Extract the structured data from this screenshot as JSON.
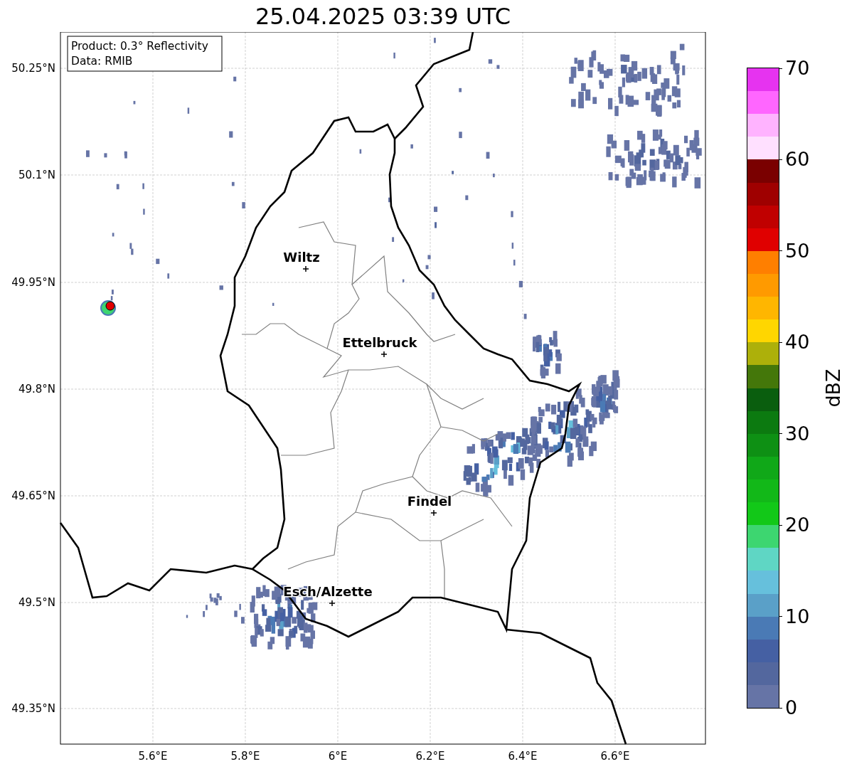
{
  "title": "25.04.2025 03:39 UTC",
  "annotation": [
    "Product: 0.3° Reflectivity",
    "Data: RMIB"
  ],
  "cities": [
    {
      "name": "Wiltz"
    },
    {
      "name": "Ettelbruck"
    },
    {
      "name": "Findel"
    },
    {
      "name": "Esch/Alzette"
    }
  ],
  "lat_ticks": [
    "50.25°N",
    "50.1°N",
    "49.95°N",
    "49.8°N",
    "49.65°N",
    "49.5°N",
    "49.35°N"
  ],
  "lon_ticks": [
    "5.6°E",
    "5.8°E",
    "6°E",
    "6.2°E",
    "6.4°E",
    "6.6°E"
  ],
  "colorbar": {
    "label": "dBZ",
    "ticks": [
      "70",
      "60",
      "50",
      "40",
      "30",
      "20",
      "10",
      "0"
    ],
    "bins": [
      {
        "color": "#6674a6"
      },
      {
        "color": "#53679e"
      },
      {
        "color": "#4560a3"
      },
      {
        "color": "#4a7ab5"
      },
      {
        "color": "#5aa0c8"
      },
      {
        "color": "#66c0dc"
      },
      {
        "color": "#5fd6c4"
      },
      {
        "color": "#3dd670"
      },
      {
        "color": "#12c818"
      },
      {
        "color": "#12b818"
      },
      {
        "color": "#10a818"
      },
      {
        "color": "#0e9014"
      },
      {
        "color": "#0c7a10"
      },
      {
        "color": "#0a5e0e"
      },
      {
        "color": "#44770a"
      },
      {
        "color": "#adb00a"
      },
      {
        "color": "#ffd600"
      },
      {
        "color": "#ffb600"
      },
      {
        "color": "#ff9a00"
      },
      {
        "color": "#ff7f00"
      },
      {
        "color": "#e00000"
      },
      {
        "color": "#c00000"
      },
      {
        "color": "#9f0000"
      },
      {
        "color": "#7a0000"
      },
      {
        "color": "#ffe0ff"
      },
      {
        "color": "#ffb3ff"
      },
      {
        "color": "#ff66ff"
      },
      {
        "color": "#e633f0"
      }
    ]
  }
}
